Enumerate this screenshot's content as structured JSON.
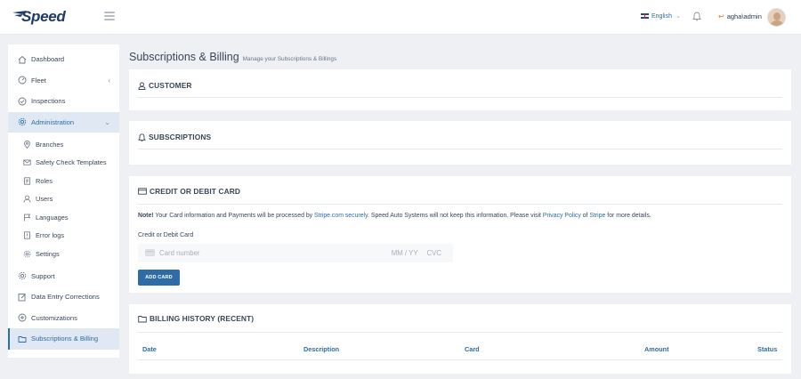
{
  "brand": {
    "logo_text": "Speed"
  },
  "header": {
    "language": "English",
    "username": "agha\\admin"
  },
  "sidebar": {
    "items": [
      {
        "label": "Dashboard",
        "icon": "home-icon"
      },
      {
        "label": "Fleet",
        "icon": "gauge-icon",
        "chevron": "‹"
      },
      {
        "label": "Inspections",
        "icon": "check-circle-icon"
      },
      {
        "label": "Administration",
        "icon": "gear-icon",
        "chevron": "⌄"
      }
    ],
    "sub_items": [
      {
        "label": "Branches",
        "icon": "map-pin-icon"
      },
      {
        "label": "Safety Check Templates",
        "icon": "envelope-icon"
      },
      {
        "label": "Roles",
        "icon": "document-icon"
      },
      {
        "label": "Users",
        "icon": "user-icon"
      },
      {
        "label": "Languages",
        "icon": "flag-icon"
      },
      {
        "label": "Error logs",
        "icon": "warning-doc-icon"
      },
      {
        "label": "Settings",
        "icon": "gear-icon"
      }
    ],
    "bottom_items": [
      {
        "label": "Support",
        "icon": "gear-icon"
      },
      {
        "label": "Data Entry Corrections",
        "icon": "edit-icon"
      },
      {
        "label": "Customizations",
        "icon": "plus-circle-icon"
      },
      {
        "label": "Subscriptions & Billing",
        "icon": "folder-icon"
      }
    ]
  },
  "page": {
    "title": "Subscriptions & Billing",
    "subtitle": "Manage your Subscriptions & Billings"
  },
  "customer": {
    "title": "CUSTOMER"
  },
  "subscriptions": {
    "title": "SUBSCRIPTIONS"
  },
  "card": {
    "title": "CREDIT OR DEBIT CARD",
    "note_bold": "Note!",
    "note_1": " Your Card information and Payments will be processed by ",
    "note_link_1": "Stripe.com securely",
    "note_2": ". Speed Auto Systems will not keep this information. Please visit ",
    "note_link_2": "Privacy Policy",
    "note_3": " of ",
    "note_link_3": "Stripe",
    "note_4": " for more details.",
    "field_label": "Credit or Debit Card",
    "number_placeholder": "Card number",
    "expiry_placeholder": "MM / YY",
    "cvc_placeholder": "CVC",
    "button_label": "ADD CARD"
  },
  "billing": {
    "title": "BILLING HISTORY (RECENT)",
    "columns": [
      "Date",
      "Description",
      "Card",
      "Amount",
      "Status"
    ]
  },
  "colors": {
    "accent": "#2e6ca8",
    "brand_navy": "#1f3a68",
    "background": "#eef0f4"
  }
}
